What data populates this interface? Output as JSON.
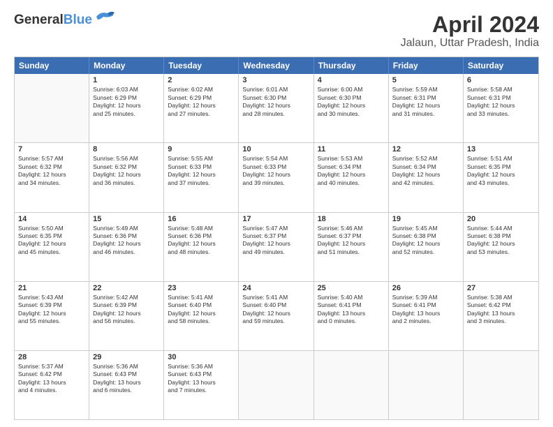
{
  "logo": {
    "line1": "General",
    "line2": "Blue"
  },
  "title": "April 2024",
  "subtitle": "Jalaun, Uttar Pradesh, India",
  "header_days": [
    "Sunday",
    "Monday",
    "Tuesday",
    "Wednesday",
    "Thursday",
    "Friday",
    "Saturday"
  ],
  "weeks": [
    [
      {
        "day": "",
        "info": ""
      },
      {
        "day": "1",
        "info": "Sunrise: 6:03 AM\nSunset: 6:29 PM\nDaylight: 12 hours\nand 25 minutes."
      },
      {
        "day": "2",
        "info": "Sunrise: 6:02 AM\nSunset: 6:29 PM\nDaylight: 12 hours\nand 27 minutes."
      },
      {
        "day": "3",
        "info": "Sunrise: 6:01 AM\nSunset: 6:30 PM\nDaylight: 12 hours\nand 28 minutes."
      },
      {
        "day": "4",
        "info": "Sunrise: 6:00 AM\nSunset: 6:30 PM\nDaylight: 12 hours\nand 30 minutes."
      },
      {
        "day": "5",
        "info": "Sunrise: 5:59 AM\nSunset: 6:31 PM\nDaylight: 12 hours\nand 31 minutes."
      },
      {
        "day": "6",
        "info": "Sunrise: 5:58 AM\nSunset: 6:31 PM\nDaylight: 12 hours\nand 33 minutes."
      }
    ],
    [
      {
        "day": "7",
        "info": "Sunrise: 5:57 AM\nSunset: 6:32 PM\nDaylight: 12 hours\nand 34 minutes."
      },
      {
        "day": "8",
        "info": "Sunrise: 5:56 AM\nSunset: 6:32 PM\nDaylight: 12 hours\nand 36 minutes."
      },
      {
        "day": "9",
        "info": "Sunrise: 5:55 AM\nSunset: 6:33 PM\nDaylight: 12 hours\nand 37 minutes."
      },
      {
        "day": "10",
        "info": "Sunrise: 5:54 AM\nSunset: 6:33 PM\nDaylight: 12 hours\nand 39 minutes."
      },
      {
        "day": "11",
        "info": "Sunrise: 5:53 AM\nSunset: 6:34 PM\nDaylight: 12 hours\nand 40 minutes."
      },
      {
        "day": "12",
        "info": "Sunrise: 5:52 AM\nSunset: 6:34 PM\nDaylight: 12 hours\nand 42 minutes."
      },
      {
        "day": "13",
        "info": "Sunrise: 5:51 AM\nSunset: 6:35 PM\nDaylight: 12 hours\nand 43 minutes."
      }
    ],
    [
      {
        "day": "14",
        "info": "Sunrise: 5:50 AM\nSunset: 6:35 PM\nDaylight: 12 hours\nand 45 minutes."
      },
      {
        "day": "15",
        "info": "Sunrise: 5:49 AM\nSunset: 6:36 PM\nDaylight: 12 hours\nand 46 minutes."
      },
      {
        "day": "16",
        "info": "Sunrise: 5:48 AM\nSunset: 6:36 PM\nDaylight: 12 hours\nand 48 minutes."
      },
      {
        "day": "17",
        "info": "Sunrise: 5:47 AM\nSunset: 6:37 PM\nDaylight: 12 hours\nand 49 minutes."
      },
      {
        "day": "18",
        "info": "Sunrise: 5:46 AM\nSunset: 6:37 PM\nDaylight: 12 hours\nand 51 minutes."
      },
      {
        "day": "19",
        "info": "Sunrise: 5:45 AM\nSunset: 6:38 PM\nDaylight: 12 hours\nand 52 minutes."
      },
      {
        "day": "20",
        "info": "Sunrise: 5:44 AM\nSunset: 6:38 PM\nDaylight: 12 hours\nand 53 minutes."
      }
    ],
    [
      {
        "day": "21",
        "info": "Sunrise: 5:43 AM\nSunset: 6:39 PM\nDaylight: 12 hours\nand 55 minutes."
      },
      {
        "day": "22",
        "info": "Sunrise: 5:42 AM\nSunset: 6:39 PM\nDaylight: 12 hours\nand 56 minutes."
      },
      {
        "day": "23",
        "info": "Sunrise: 5:41 AM\nSunset: 6:40 PM\nDaylight: 12 hours\nand 58 minutes."
      },
      {
        "day": "24",
        "info": "Sunrise: 5:41 AM\nSunset: 6:40 PM\nDaylight: 12 hours\nand 59 minutes."
      },
      {
        "day": "25",
        "info": "Sunrise: 5:40 AM\nSunset: 6:41 PM\nDaylight: 13 hours\nand 0 minutes."
      },
      {
        "day": "26",
        "info": "Sunrise: 5:39 AM\nSunset: 6:41 PM\nDaylight: 13 hours\nand 2 minutes."
      },
      {
        "day": "27",
        "info": "Sunrise: 5:38 AM\nSunset: 6:42 PM\nDaylight: 13 hours\nand 3 minutes."
      }
    ],
    [
      {
        "day": "28",
        "info": "Sunrise: 5:37 AM\nSunset: 6:42 PM\nDaylight: 13 hours\nand 4 minutes."
      },
      {
        "day": "29",
        "info": "Sunrise: 5:36 AM\nSunset: 6:43 PM\nDaylight: 13 hours\nand 6 minutes."
      },
      {
        "day": "30",
        "info": "Sunrise: 5:36 AM\nSunset: 6:43 PM\nDaylight: 13 hours\nand 7 minutes."
      },
      {
        "day": "",
        "info": ""
      },
      {
        "day": "",
        "info": ""
      },
      {
        "day": "",
        "info": ""
      },
      {
        "day": "",
        "info": ""
      }
    ]
  ]
}
